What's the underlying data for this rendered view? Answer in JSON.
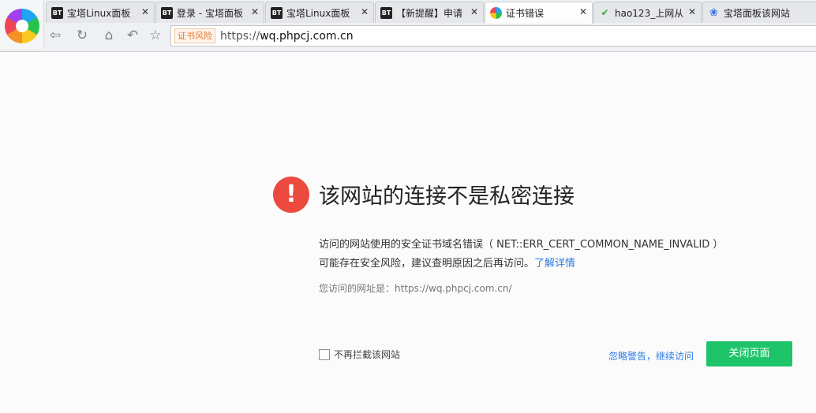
{
  "tabs": [
    {
      "label": "宝塔Linux面板",
      "icon": "bt-icon",
      "favicon_text": "BT"
    },
    {
      "label": "登录 - 宝塔面板",
      "icon": "bt-icon",
      "favicon_text": "BT"
    },
    {
      "label": "宝塔Linux面板",
      "icon": "bt-icon",
      "favicon_text": "BT"
    },
    {
      "label": "【新提醒】申请",
      "icon": "bt-icon",
      "favicon_text": "BT"
    },
    {
      "label": "证书错误",
      "icon": "browser-logo-icon",
      "active": true
    },
    {
      "label": "hao123_上网从",
      "icon": "hao123-icon"
    },
    {
      "label": "宝塔面板该网站",
      "icon": "baidu-icon"
    }
  ],
  "address_bar": {
    "cert_badge": "证书风险",
    "scheme": "https://",
    "host": "wq.phpcj.com.cn"
  },
  "error": {
    "title": "该网站的连接不是私密连接",
    "line1": "访问的网站使用的安全证书域名错误（ NET::ERR_CERT_COMMON_NAME_INVALID ）",
    "line2": "可能存在安全风险，建议查明原因之后再访问。",
    "learn_more": "了解详情",
    "visited_url": "您访问的网址是：https://wq.phpcj.com.cn/"
  },
  "actions": {
    "no_block_label": "不再拦截该网站",
    "ignore_label": "忽略警告，继续访问",
    "close_label": "关闭页面"
  },
  "colors": {
    "error_red": "#ec4a3e",
    "close_green": "#1dc46a",
    "link_blue": "#2c7be5"
  }
}
